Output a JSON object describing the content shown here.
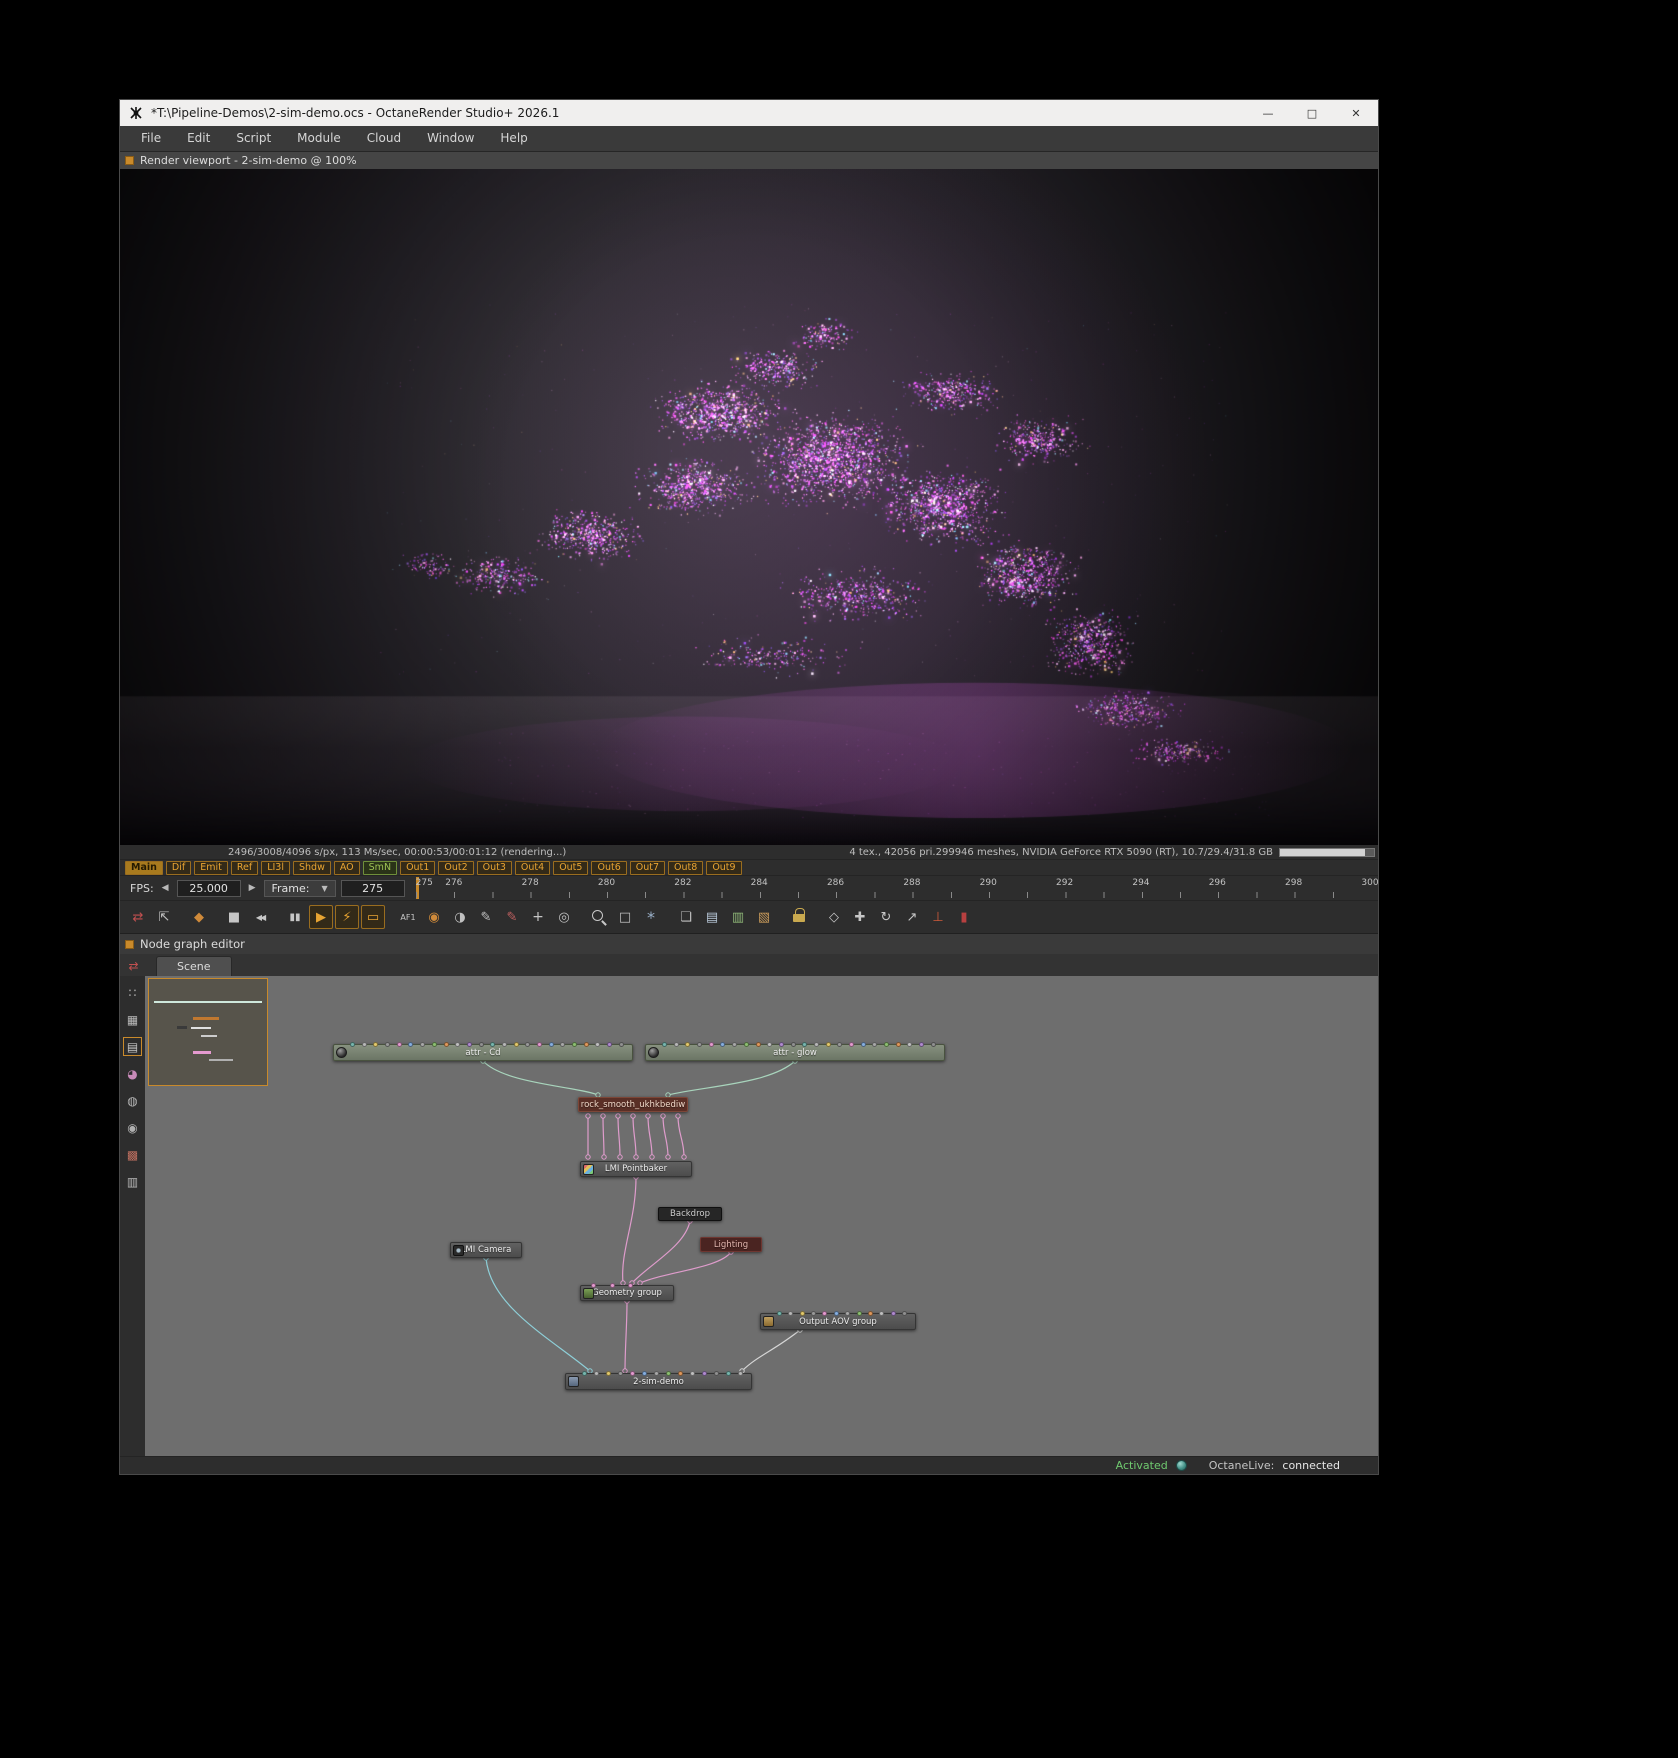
{
  "theme": {
    "titlebar_bg": "#f0efee",
    "accent_orange": "#c98a2b",
    "pass_text": "#e8a432",
    "pass_green": "#9dc053",
    "activated_green": "#6fc96f",
    "edge_pink": "#df9ccc",
    "edge_cyan": "#8ecfd8",
    "edge_green": "#a8d4bc",
    "edge_gray": "#d6d6d6",
    "graph_bg": "#6e6e6e"
  },
  "window": {
    "title": "*T:\\Pipeline-Demos\\2-sim-demo.ocs - OctaneRender Studio+ 2026.1",
    "controls": {
      "minimize": "—",
      "maximize": "□",
      "close": "✕"
    }
  },
  "menu": [
    "File",
    "Edit",
    "Script",
    "Module",
    "Cloud",
    "Window",
    "Help"
  ],
  "viewport": {
    "title": "Render viewport - 2-sim-demo @ 100%"
  },
  "render_status": {
    "left": "2496/3008/4096 s/px, 113 Ms/sec, 00:00:53/00:01:12 (rendering...)",
    "right": "4 tex., 42056 pri.299946 meshes, NVIDIA GeForce RTX 5090 (RT), 10.7/29.4/31.8 GB",
    "progress_percent": 90
  },
  "passes": [
    {
      "label": "Main",
      "state": "active"
    },
    {
      "label": "Dif"
    },
    {
      "label": "Emit"
    },
    {
      "label": "Ref"
    },
    {
      "label": "LI3l"
    },
    {
      "label": "Shdw"
    },
    {
      "label": "AO"
    },
    {
      "label": "SmN",
      "variant": "green"
    },
    {
      "label": "Out1"
    },
    {
      "label": "Out2"
    },
    {
      "label": "Out3"
    },
    {
      "label": "Out4"
    },
    {
      "label": "Out5"
    },
    {
      "label": "Out6"
    },
    {
      "label": "Out7"
    },
    {
      "label": "Out8"
    },
    {
      "label": "Out9"
    }
  ],
  "transport": {
    "fps_label": "FPS:",
    "fps_value": "25.000",
    "frame_label": "Frame:",
    "frame_value": "275"
  },
  "timeline": {
    "start": 275,
    "end": 300,
    "labels": [
      275,
      276,
      278,
      280,
      282,
      284,
      286,
      288,
      290,
      292,
      294,
      296,
      298,
      300
    ]
  },
  "toolbar": [
    {
      "name": "compare-ab-button",
      "glyph": "⇄",
      "color": "#c25050"
    },
    {
      "name": "fit-view-button",
      "glyph": "⇱",
      "color": "#c0c0c0"
    },
    {
      "name": "material-ball-button",
      "glyph": "◆",
      "color": "#cf8a3a",
      "gap": true
    },
    {
      "name": "stop-render-button",
      "glyph": "■",
      "gap": true
    },
    {
      "name": "restart-render-button",
      "glyph": "◀◀",
      "size": 8
    },
    {
      "name": "pause-render-button",
      "glyph": "▮▮",
      "size": 10,
      "gap": true
    },
    {
      "name": "play-render-button",
      "glyph": "▶",
      "boxed": true,
      "color": "#e8a432"
    },
    {
      "name": "realtime-render-button",
      "glyph": "⚡",
      "boxed": true,
      "color": "#e8a432"
    },
    {
      "name": "display-mode-button",
      "glyph": "▭",
      "boxed": true,
      "color": "#e8a432"
    },
    {
      "name": "autofocus-button",
      "glyph": "AF1",
      "size": 8,
      "gap": true
    },
    {
      "name": "aperture-button",
      "glyph": "◉",
      "color": "#cf8a3a"
    },
    {
      "name": "white-balance-button",
      "glyph": "◑",
      "color": "#c0c0c0"
    },
    {
      "name": "render-region-pen-button",
      "glyph": "✎",
      "color": "#c0c0c0"
    },
    {
      "name": "film-region-pen-button",
      "glyph": "✎",
      "color": "#c06060"
    },
    {
      "name": "focus-picker-button",
      "glyph": "+",
      "size": 14
    },
    {
      "name": "material-picker-button",
      "glyph": "◎",
      "color": "#c0c0c0"
    },
    {
      "name": "zoom-tool-button",
      "glyph": "",
      "cls": "icon-zoom",
      "gap": true
    },
    {
      "name": "region-select-button",
      "glyph": "□",
      "color": "#c0c0c0"
    },
    {
      "name": "freeze-render-button",
      "glyph": "*",
      "size": 16,
      "color": "#9ab0c8"
    },
    {
      "name": "copy-image-button",
      "glyph": "❏",
      "color": "#c0c0c0",
      "gap": true
    },
    {
      "name": "clipboard-image-button",
      "glyph": "▤",
      "color": "#b8c8d8"
    },
    {
      "name": "save-image-button",
      "glyph": "▥",
      "color": "#8fb878"
    },
    {
      "name": "export-image-button",
      "glyph": "▧",
      "color": "#c89a5a"
    },
    {
      "name": "lock-image-button",
      "glyph": "",
      "cls": "icon-lock",
      "gap": true
    },
    {
      "name": "orientation-cube-button",
      "glyph": "◇",
      "gap": true
    },
    {
      "name": "move-camera-button",
      "glyph": "✚"
    },
    {
      "name": "rotate-camera-button",
      "glyph": "↻"
    },
    {
      "name": "zoom-camera-button",
      "glyph": "↗"
    },
    {
      "name": "axis-gizmo-button",
      "glyph": "⊥",
      "color": "#cf5a3a"
    },
    {
      "name": "abort-button",
      "glyph": "▮",
      "color": "#b84040"
    }
  ],
  "rail_top": {
    "name": "graph-sync-icon",
    "glyph": "⇄",
    "color": "#c25050"
  },
  "rail": [
    {
      "name": "rail-nodes-icon",
      "glyph": "∷",
      "color": "#b8b8b8"
    },
    {
      "name": "rail-grid-icon",
      "glyph": "▦",
      "color": "#b8b8b8"
    },
    {
      "name": "rail-list-icon",
      "glyph": "▤",
      "color": "#c8c8c8",
      "selected": true
    },
    {
      "name": "rail-palette-icon",
      "glyph": "◕",
      "color": "#c88ab8"
    },
    {
      "name": "rail-sphere-icon",
      "glyph": "◍",
      "color": "#b8b8b8"
    },
    {
      "name": "rail-shader-icon",
      "glyph": "◉",
      "color": "#b0b0b0"
    },
    {
      "name": "rail-material-icon",
      "glyph": "▩",
      "color": "#c07060"
    },
    {
      "name": "rail-texture-icon",
      "glyph": "▥",
      "color": "#b8b8b8"
    }
  ],
  "node_editor": {
    "header": "Node graph editor",
    "tab": "Scene",
    "nodes": {
      "attr_cd": {
        "label": "attr - Cd"
      },
      "attr_glow": {
        "label": "attr - glow"
      },
      "rock": {
        "label": "rock_smooth_ukhkbediw"
      },
      "pointbaker": {
        "label": "LMI Pointbaker"
      },
      "backdrop": {
        "label": "Backdrop"
      },
      "lighting": {
        "label": "Lighting"
      },
      "camera": {
        "label": "LMI Camera"
      },
      "geometry": {
        "label": "Geometry group"
      },
      "aov": {
        "label": "Output AOV group"
      },
      "root": {
        "label": "2-sim-demo"
      }
    },
    "pin_palettes": {
      "multi": [
        "#76b6ae",
        "#b8b8b8",
        "#e3c96b",
        "#9a9a9a",
        "#e59ad0",
        "#85aee0",
        "#a8a8a8",
        "#8cc070",
        "#e0985a",
        "#c0c0c0",
        "#b08ad0",
        "#909090"
      ],
      "pink": [
        "#e59ad0"
      ],
      "teal": [
        "#76b6ae"
      ]
    }
  },
  "footer": {
    "activated": "Activated",
    "octanelive_label": "OctaneLive:",
    "octanelive_value": "connected"
  }
}
